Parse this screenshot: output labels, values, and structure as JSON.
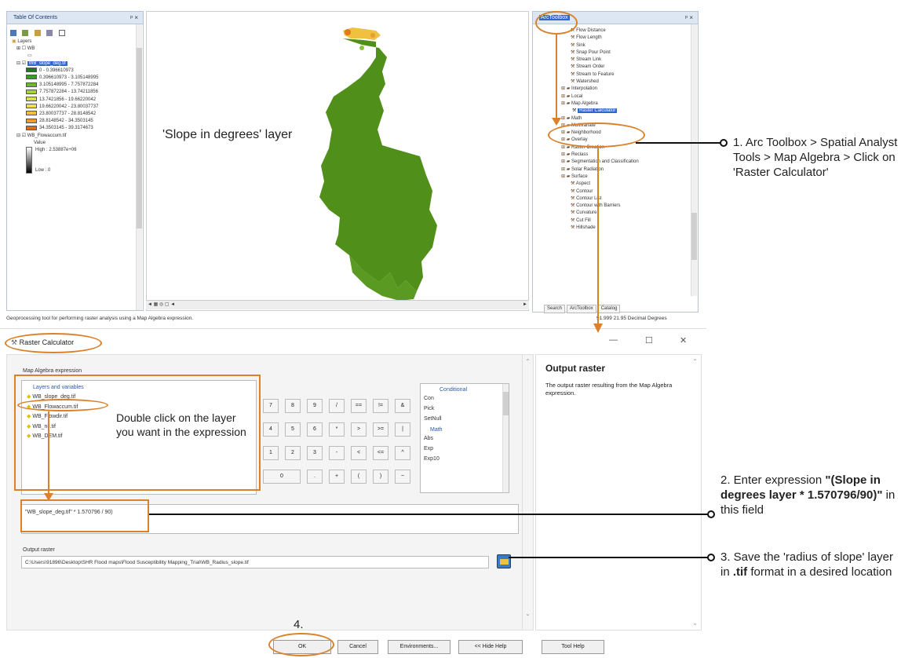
{
  "toc": {
    "title": "Table Of Contents",
    "close": "ᵖ ×",
    "layers_root": "Layers",
    "wb_layer": "WB",
    "slope_layer": "WB_slope_deg.tif",
    "classes": [
      {
        "label": "0 - 0.396610973",
        "color": "#1f7a1f"
      },
      {
        "label": "0.396610973 - 3.105148995",
        "color": "#3a9a2a"
      },
      {
        "label": "3.105148995 - 7.757872284",
        "color": "#6aba2a"
      },
      {
        "label": "7.757872284 - 13.74211856",
        "color": "#a6d23a"
      },
      {
        "label": "13.7421856 - 19.66220042",
        "color": "#d6e24a"
      },
      {
        "label": "19.66220042 - 23.80037737",
        "color": "#f0e04a"
      },
      {
        "label": "23.80037737 - 28.8148542",
        "color": "#f2c03a"
      },
      {
        "label": "28.8148542 - 34.3503145",
        "color": "#f09a2a"
      },
      {
        "label": "34.3503145 - 39.3174673",
        "color": "#e06a1a"
      }
    ],
    "flowaccum_layer": "WB_Flowaccum.tif",
    "value_label": "Value",
    "high_label": "High : 2.53887e+06",
    "low_label": "Low : 0"
  },
  "map": {
    "annotation": "'Slope in degrees' layer",
    "status_text": "Geoprocessing tool for performing raster analysis using a Map Algebra expression.",
    "coords": "91.999 21.95 Decimal Degrees"
  },
  "toolbox": {
    "title": "ArcToolbox",
    "close": "ᵖ ×",
    "tools": [
      "Flow Distance",
      "Flow Length",
      "Sink",
      "Snap Pour Point",
      "Stream Link",
      "Stream Order",
      "Stream to Feature",
      "Watershed"
    ],
    "toolsets": [
      "Interpolation",
      "Local",
      "Map Algebra"
    ],
    "selected_tool": "Raster Calculator",
    "toolsets2": [
      "Math",
      "Multivariate",
      "Neighborhood",
      "Overlay",
      "Raster Creation",
      "Reclass",
      "Segmentation and Classification",
      "Solar Radiation",
      "Surface"
    ],
    "surface_tools": [
      "Aspect",
      "Contour",
      "Contour List",
      "Contour with Barriers",
      "Curvature",
      "Cut Fill",
      "Hillshade"
    ],
    "tabs": [
      "Search",
      "ArcToolbox",
      "Catalog"
    ]
  },
  "dialog": {
    "title": "Raster Calculator",
    "expr_label": "Map Algebra expression",
    "layers_header": "Layers and variables",
    "layers": [
      "WB_slope_deg.tif",
      "WB_Flowaccum.tif",
      "WB_Flowdir.tif",
      "WB_nil.tif",
      "WB_DEM.tif"
    ],
    "keys": [
      [
        "7",
        "8",
        "9",
        "/",
        "==",
        "!=",
        "&"
      ],
      [
        "4",
        "5",
        "6",
        "*",
        ">",
        ">=",
        "|"
      ],
      [
        "1",
        "2",
        "3",
        "-",
        "<",
        "<=",
        "^"
      ],
      [
        "0",
        ".",
        "+",
        "(",
        ")",
        "~"
      ]
    ],
    "cond_header": "Conditional",
    "cond_items": [
      "Con",
      "Pick",
      "SetNull"
    ],
    "math_header": "Math",
    "math_items": [
      "Abs",
      "Exp",
      "Exp10"
    ],
    "expression": "\"WB_slope_deg.tif\" * 1.570796 / 90)",
    "output_label": "Output raster",
    "output_path": "C:\\Users\\91896\\Desktop\\SHR Flood maps\\Flood Susceptibility Mapping_Trial\\WB_Radius_slope.tif",
    "help_title": "Output raster",
    "help_text": "The output raster resulting from the Map Algebra expression.",
    "buttons": {
      "ok": "OK",
      "cancel": "Cancel",
      "env": "Environments...",
      "hide": "<< Hide Help",
      "help": "Tool Help"
    },
    "win_min": "—",
    "win_max": "☐",
    "win_close": "✕"
  },
  "annotations": {
    "double_click": "Double click on the layer you want in the expression",
    "step1": "1. Arc Toolbox > Spatial Analyst Tools > Map Algebra > Click on 'Raster Calculator'",
    "step2_pre": "2. Enter expression",
    "step2_bold": "\"(Slope in degrees layer * 1.570796/90)\"",
    "step2_post": " in this field",
    "step3_pre": "3. Save the 'radius of slope' layer in ",
    "step3_bold": ".tif",
    "step3_post": " format in a desired location",
    "step4": "4."
  },
  "colors": {
    "accent": "#d9822b",
    "map_green": "#4f8f1a",
    "selection": "#3366cc"
  }
}
